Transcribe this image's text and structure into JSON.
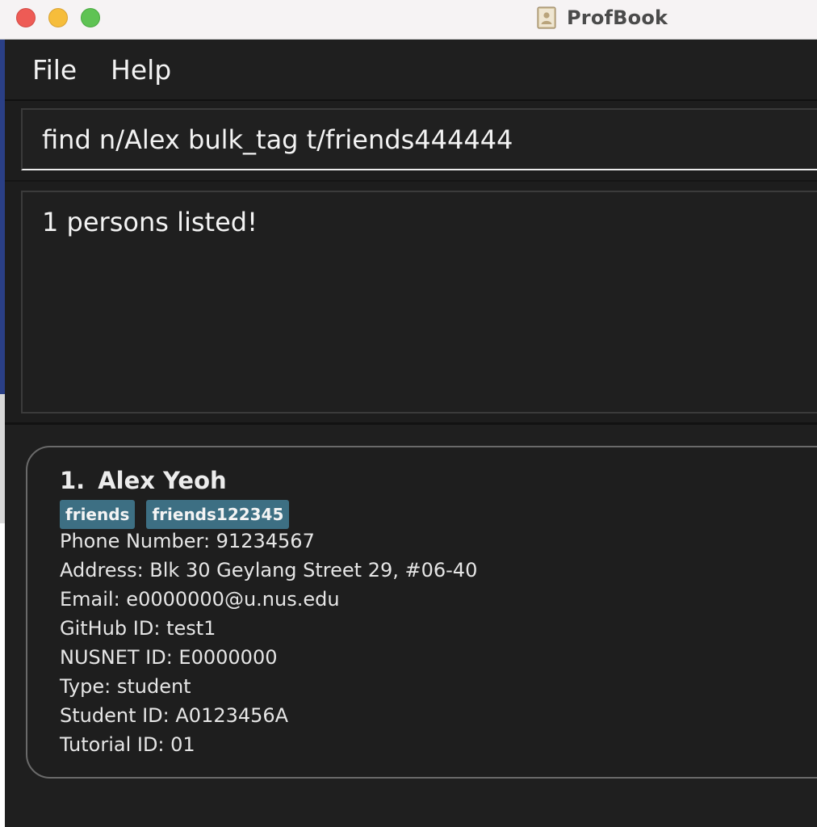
{
  "window": {
    "title": "ProfBook",
    "app_icon": "address-book-icon",
    "buttons": [
      "close-icon",
      "minimize-icon",
      "maximize-icon"
    ]
  },
  "menu": {
    "items": [
      "File",
      "Help"
    ]
  },
  "command_box": {
    "value": "find n/Alex bulk_tag t/friends444444"
  },
  "result_display": {
    "text": "1 persons listed!"
  },
  "person_list": [
    {
      "index": "1.",
      "name": "Alex Yeoh",
      "tags": [
        "friends",
        "friends122345"
      ],
      "phone": "Phone Number: 91234567",
      "address": "Address: Blk 30 Geylang Street 29, #06-40",
      "email": "Email: e0000000@u.nus.edu",
      "github": "GitHub ID: test1",
      "nusnet": "NUSNET ID: E0000000",
      "type": "Type: student",
      "student_id": "Student ID: A0123456A",
      "tutorial_id": "Tutorial ID: 01"
    }
  ],
  "colors": {
    "background": "#1e1e1e",
    "text": "#f3f3f3",
    "tag": "#3d6f83",
    "titlebar": "#f6f3f4",
    "close": "#ee5b55",
    "minimize": "#f6bd3b",
    "maximize": "#5fc354"
  }
}
